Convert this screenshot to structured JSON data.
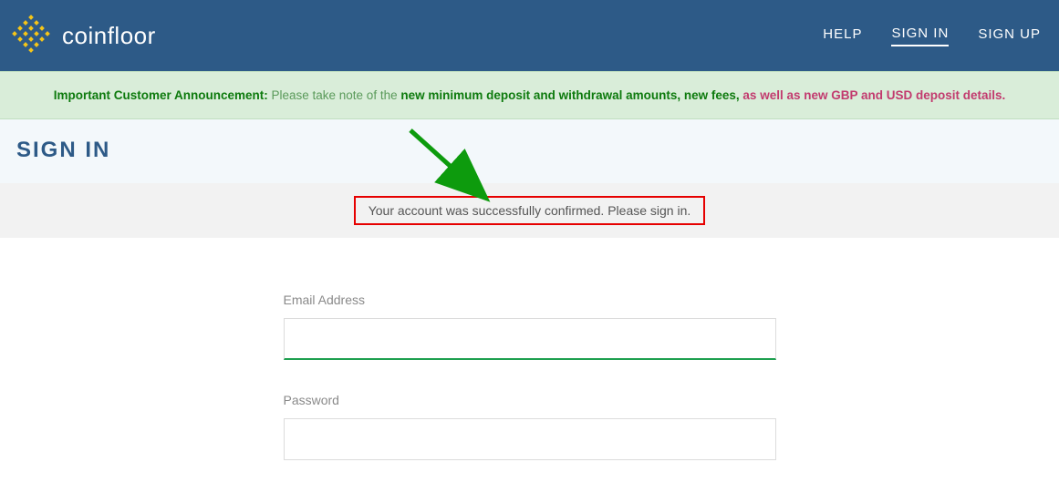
{
  "brand": {
    "name": "coinfloor"
  },
  "nav": {
    "help": "HELP",
    "signin": "SIGN IN",
    "signup": "SIGN UP"
  },
  "announcement": {
    "prefix": "Important Customer Announcement:",
    "middle_plain": " Please take note of the ",
    "link1": "new minimum deposit and withdrawal amounts, new fees,",
    "between": " ",
    "link2": "as well as new GBP and USD deposit details."
  },
  "page": {
    "title": "SIGN IN"
  },
  "notice": {
    "text": "Your account was successfully confirmed. Please sign in."
  },
  "form": {
    "email_label": "Email Address",
    "email_value": "",
    "password_label": "Password",
    "password_value": ""
  },
  "colors": {
    "header_bg": "#2d5a87",
    "announcement_bg": "#d9edd9",
    "accent_green": "#1fa050",
    "highlight_red": "#e60000",
    "link_magenta": "#c23a6e"
  }
}
